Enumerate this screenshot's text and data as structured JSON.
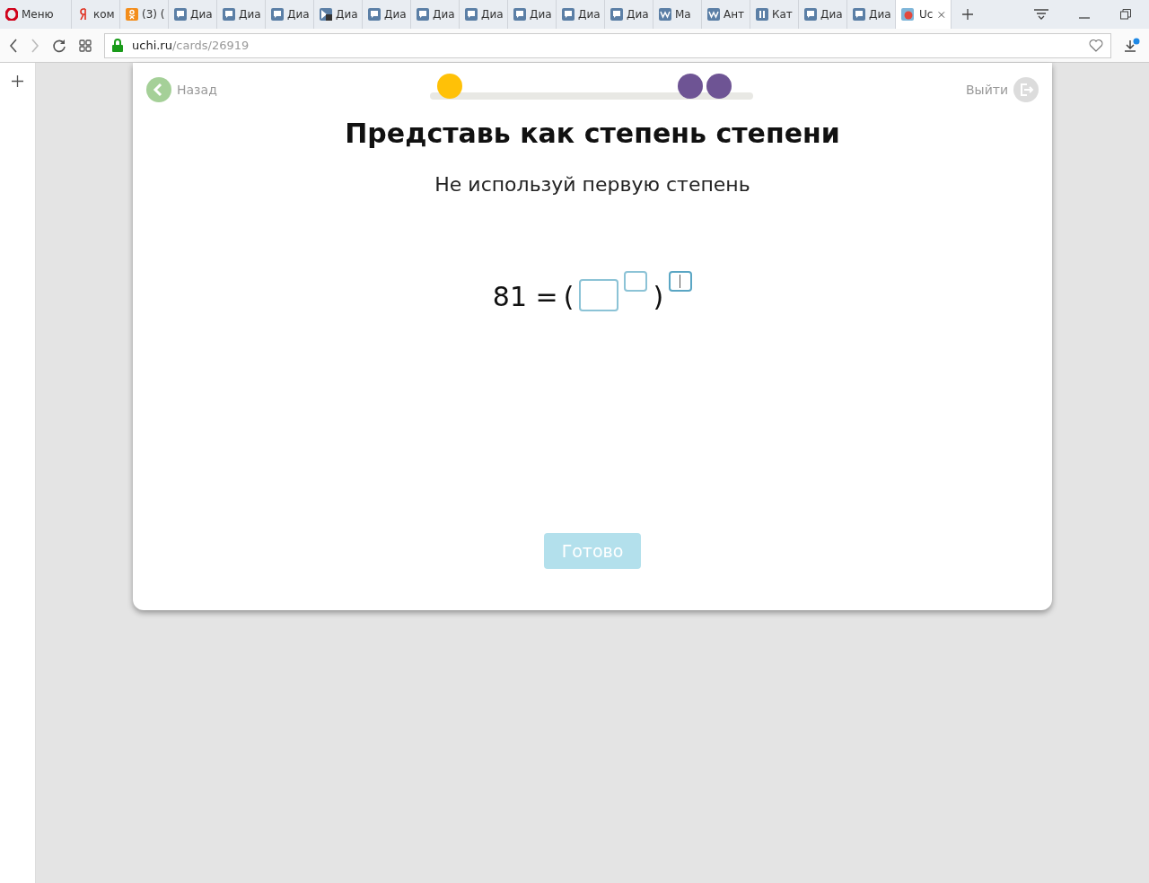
{
  "browser": {
    "tabs": [
      {
        "kind": "opera",
        "label": "Меню",
        "selected": false
      },
      {
        "kind": "yandex",
        "label": "ком",
        "selected": false
      },
      {
        "kind": "ok",
        "label": "(3) (",
        "selected": false
      },
      {
        "kind": "chat",
        "label": "Диа",
        "selected": false
      },
      {
        "kind": "chat",
        "label": "Диа",
        "selected": false
      },
      {
        "kind": "chat",
        "label": "Диа",
        "selected": false
      },
      {
        "kind": "media",
        "label": "Диа",
        "selected": false
      },
      {
        "kind": "chat",
        "label": "Диа",
        "selected": false
      },
      {
        "kind": "chat",
        "label": "Диа",
        "selected": false
      },
      {
        "kind": "chat",
        "label": "Диа",
        "selected": false
      },
      {
        "kind": "chat",
        "label": "Диа",
        "selected": false
      },
      {
        "kind": "chat",
        "label": "Диа",
        "selected": false
      },
      {
        "kind": "chat",
        "label": "Диа",
        "selected": false
      },
      {
        "kind": "vk",
        "label": "Ма",
        "selected": false
      },
      {
        "kind": "vk",
        "label": "Ант",
        "selected": false
      },
      {
        "kind": "pause",
        "label": "Кат",
        "selected": false
      },
      {
        "kind": "chat",
        "label": "Диа",
        "selected": false
      },
      {
        "kind": "chat",
        "label": "Диа",
        "selected": false
      },
      {
        "kind": "site",
        "label": "Uc",
        "selected": true
      }
    ],
    "address": {
      "host": "uchi.ru",
      "path": "/cards/26919"
    }
  },
  "card": {
    "back": "Назад",
    "exit": "Выйти",
    "progress": [
      {
        "color": "#ffc107"
      },
      {
        "color": "#6e5494"
      },
      {
        "color": "#6e5494"
      }
    ],
    "title": "Представь как степень степени",
    "subtitle": "Не используй первую степень",
    "equation": {
      "left": "81 =",
      "open": "(",
      "close": ")",
      "fields": [
        {
          "focused": false
        },
        {
          "focused": false
        },
        {
          "focused": true
        }
      ]
    },
    "submit": {
      "label": "Готово",
      "disabled": true
    }
  }
}
